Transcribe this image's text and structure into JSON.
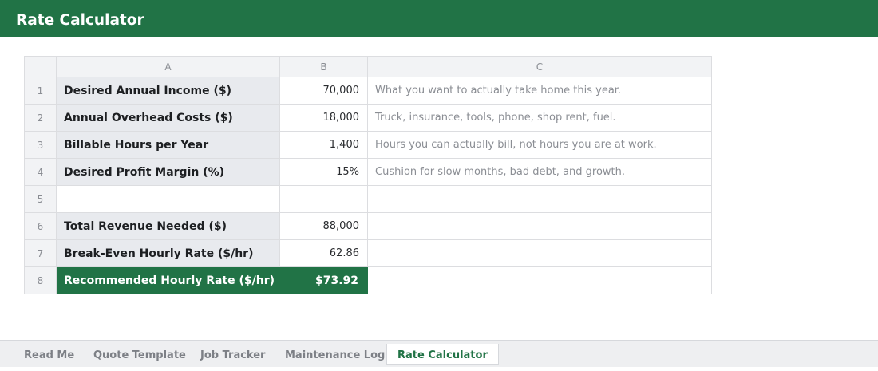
{
  "window": {
    "title": "Rate Calculator"
  },
  "colors": {
    "accent": "#217346",
    "label_bg": "#e8eaee",
    "header_bg": "#f2f3f5"
  },
  "columns": [
    "A",
    "B",
    "C"
  ],
  "rows": [
    {
      "num": "1",
      "label": "Desired Annual Income ($)",
      "value": "70,000",
      "note": "What you want to actually take home this year."
    },
    {
      "num": "2",
      "label": "Annual Overhead Costs ($)",
      "value": "18,000",
      "note": "Truck, insurance, tools, phone, shop rent, fuel."
    },
    {
      "num": "3",
      "label": "Billable Hours per Year",
      "value": "1,400",
      "note": "Hours you can actually bill, not hours you are at work."
    },
    {
      "num": "4",
      "label": "Desired Profit Margin (%)",
      "value": "15%",
      "note": "Cushion for slow months, bad debt, and growth."
    },
    {
      "num": "5",
      "label": "",
      "value": "",
      "note": ""
    },
    {
      "num": "6",
      "label": "Total Revenue Needed ($)",
      "value": "88,000",
      "note": ""
    },
    {
      "num": "7",
      "label": "Break-Even Hourly Rate ($/hr)",
      "value": "62.86",
      "note": ""
    },
    {
      "num": "8",
      "label": "Recommended Hourly Rate ($/hr)",
      "value": "$73.92",
      "note": ""
    }
  ],
  "tabs": [
    {
      "label": "Read Me",
      "active": false
    },
    {
      "label": "Quote Template",
      "active": false
    },
    {
      "label": "Job Tracker",
      "active": false
    },
    {
      "label": "Maintenance Log",
      "active": false
    },
    {
      "label": "Rate Calculator",
      "active": true
    }
  ]
}
